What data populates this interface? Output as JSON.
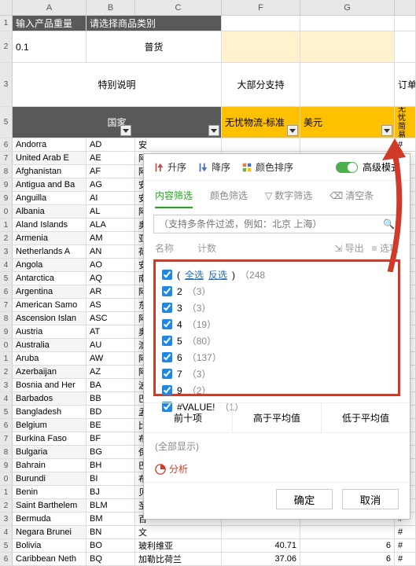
{
  "columns": {
    "rn": "",
    "a": "A",
    "b": "B",
    "c": "C",
    "f": "F",
    "g": "G",
    "h": ""
  },
  "header_row1": {
    "rn": "1",
    "a": "输入产品重量",
    "b": "请选择商品类别"
  },
  "header_row2": {
    "rn": "2",
    "a": "0.1",
    "c": "普货"
  },
  "header_row3": {
    "rn": "3",
    "ac": "特别说明",
    "f": "大部分支持",
    "h": "订单"
  },
  "header_row5": {
    "rn": "5",
    "country": "国家",
    "f": "无忧物流-标准",
    "g": "美元",
    "h": "无忧\n简易"
  },
  "rows": [
    {
      "rn": "6",
      "a": "Andorra",
      "b": "AD",
      "c": "安"
    },
    {
      "rn": "7",
      "a": "United Arab E",
      "b": "AE",
      "c": "阿"
    },
    {
      "rn": "8",
      "a": "Afghanistan",
      "b": "AF",
      "c": "阿"
    },
    {
      "rn": "9",
      "a": "Antigua and Ba",
      "b": "AG",
      "c": "安"
    },
    {
      "rn": "9",
      "a": "Anguilla",
      "b": "AI",
      "c": "安"
    },
    {
      "rn": "0",
      "a": "Albania",
      "b": "AL",
      "c": "阿"
    },
    {
      "rn": "1",
      "a": "Aland Islands",
      "b": "ALA",
      "c": "奥"
    },
    {
      "rn": "2",
      "a": "Armenia",
      "b": "AM",
      "c": "亚"
    },
    {
      "rn": "3",
      "a": "Netherlands A",
      "b": "AN",
      "c": "荷"
    },
    {
      "rn": "4",
      "a": "Angola",
      "b": "AO",
      "c": "安"
    },
    {
      "rn": "5",
      "a": "Antarctica",
      "b": "AQ",
      "c": "南"
    },
    {
      "rn": "6",
      "a": "Argentina",
      "b": "AR",
      "c": "阿"
    },
    {
      "rn": "7",
      "a": "American Samo",
      "b": "AS",
      "c": "东"
    },
    {
      "rn": "8",
      "a": "Ascension Islan",
      "b": "ASC",
      "c": "阿"
    },
    {
      "rn": "9",
      "a": "Austria",
      "b": "AT",
      "c": "奥"
    },
    {
      "rn": "0",
      "a": "Australia",
      "b": "AU",
      "c": "澳"
    },
    {
      "rn": "1",
      "a": "Aruba",
      "b": "AW",
      "c": "阿"
    },
    {
      "rn": "2",
      "a": "Azerbaijan",
      "b": "AZ",
      "c": "阿"
    },
    {
      "rn": "3",
      "a": "Bosnia and Her",
      "b": "BA",
      "c": "波"
    },
    {
      "rn": "4",
      "a": "Barbados",
      "b": "BB",
      "c": "巴"
    },
    {
      "rn": "5",
      "a": "Bangladesh",
      "b": "BD",
      "c": "孟"
    },
    {
      "rn": "6",
      "a": "Belgium",
      "b": "BE",
      "c": "比"
    },
    {
      "rn": "7",
      "a": "Burkina Faso",
      "b": "BF",
      "c": "布"
    },
    {
      "rn": "8",
      "a": "Bulgaria",
      "b": "BG",
      "c": "保"
    },
    {
      "rn": "9",
      "a": "Bahrain",
      "b": "BH",
      "c": "巴"
    },
    {
      "rn": "0",
      "a": "Burundi",
      "b": "BI",
      "c": "布"
    },
    {
      "rn": "1",
      "a": "Benin",
      "b": "BJ",
      "c": "贝"
    },
    {
      "rn": "2",
      "a": "Saint Barthelem",
      "b": "BLM",
      "c": "圣"
    },
    {
      "rn": "3",
      "a": "Bermuda",
      "b": "BM",
      "c": "百"
    },
    {
      "rn": "4",
      "a": "Negara Brunei",
      "b": "BN",
      "c": "文"
    }
  ],
  "bottom_rows": [
    {
      "rn": "5",
      "a": "Bolivia",
      "b": "BO",
      "c": "玻利维亚",
      "f": "40.71",
      "g": "6",
      "h": "#"
    },
    {
      "rn": "6",
      "a": "Caribbean Neth",
      "b": "BQ",
      "c": "加勒比荷兰",
      "f": "37.06",
      "g": "6",
      "h": "#"
    }
  ],
  "filter": {
    "toolbar": {
      "asc": "升序",
      "desc": "降序",
      "color": "颜色排序",
      "adv": "高级模式"
    },
    "tabs": {
      "content": "内容筛选",
      "color_f": "颜色筛选",
      "number": "数字筛选",
      "clear": "清空条"
    },
    "search_placeholder": "（支持多条件过滤，例如：北京 上海）",
    "sub": {
      "name": "名称",
      "count": "计数",
      "export": "导出",
      "options": "选项"
    },
    "items": [
      {
        "label_pre": "(",
        "link1": "全选",
        "link2": "反选",
        "label_post": ")",
        "cnt": "（248"
      },
      {
        "label": "2",
        "cnt": "（3）"
      },
      {
        "label": "3",
        "cnt": "（3）"
      },
      {
        "label": "4",
        "cnt": "（19）"
      },
      {
        "label": "5",
        "cnt": "（80）"
      },
      {
        "label": "6",
        "cnt": "（137）"
      },
      {
        "label": "7",
        "cnt": "（3）"
      },
      {
        "label": "9",
        "cnt": "（2）"
      },
      {
        "label": "#VALUE!",
        "cnt": "（1）"
      }
    ],
    "quick": {
      "top10": "前十项",
      "above": "高于平均值",
      "below": "低于平均值"
    },
    "showall": "(全部显示)",
    "analyze": "分析",
    "ok": "确定",
    "cancel": "取消"
  }
}
